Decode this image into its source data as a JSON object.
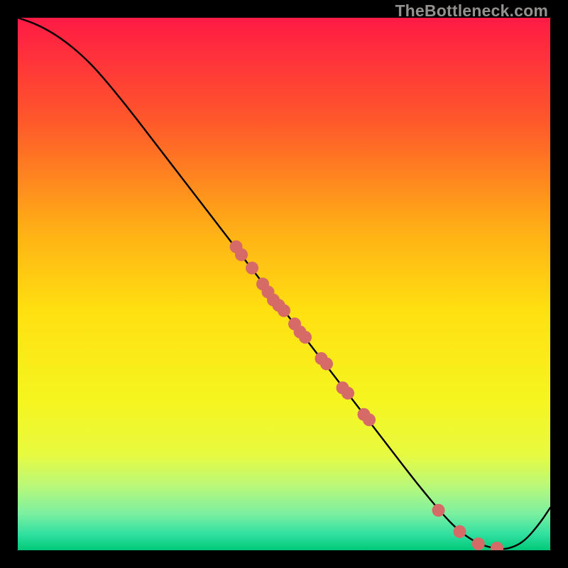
{
  "watermark": "TheBottleneck.com",
  "chart_data": {
    "type": "line",
    "title": "",
    "xlabel": "",
    "ylabel": "",
    "xlim": [
      0,
      100
    ],
    "ylim": [
      0,
      100
    ],
    "grid": false,
    "background_gradient": {
      "stops": [
        {
          "pos": 0.0,
          "color": "#ff1a45"
        },
        {
          "pos": 0.2,
          "color": "#ff5a2a"
        },
        {
          "pos": 0.4,
          "color": "#ffb015"
        },
        {
          "pos": 0.55,
          "color": "#ffe010"
        },
        {
          "pos": 0.72,
          "color": "#f5f520"
        },
        {
          "pos": 0.82,
          "color": "#e8fa40"
        },
        {
          "pos": 0.88,
          "color": "#b8f87a"
        },
        {
          "pos": 0.93,
          "color": "#7ef0a0"
        },
        {
          "pos": 0.97,
          "color": "#30e0a0"
        },
        {
          "pos": 1.0,
          "color": "#00c878"
        }
      ]
    },
    "series": [
      {
        "name": "curve",
        "color": "#000000",
        "x": [
          0,
          3,
          6,
          9,
          12,
          15,
          20,
          25,
          30,
          35,
          40,
          45,
          50,
          55,
          60,
          65,
          70,
          75,
          80,
          83,
          86,
          88,
          90,
          92,
          95,
          98,
          100
        ],
        "y": [
          100,
          99,
          97.5,
          95.5,
          93,
          90,
          84,
          77.5,
          71,
          64.5,
          58,
          51.5,
          45,
          38.5,
          32,
          25.5,
          19,
          12.5,
          6.5,
          3.5,
          1.5,
          0.7,
          0.3,
          0.2,
          1.5,
          5,
          8
        ]
      }
    ],
    "scatter": {
      "name": "markers",
      "color": "#d66a66",
      "radius": 9,
      "points": [
        {
          "x": 41,
          "y": 57
        },
        {
          "x": 42,
          "y": 55.5
        },
        {
          "x": 44,
          "y": 53
        },
        {
          "x": 46,
          "y": 50
        },
        {
          "x": 47,
          "y": 48.5
        },
        {
          "x": 48,
          "y": 47
        },
        {
          "x": 49,
          "y": 46
        },
        {
          "x": 50,
          "y": 45
        },
        {
          "x": 52,
          "y": 42.5
        },
        {
          "x": 53,
          "y": 41
        },
        {
          "x": 54,
          "y": 40
        },
        {
          "x": 57,
          "y": 36
        },
        {
          "x": 58,
          "y": 35
        },
        {
          "x": 61,
          "y": 30.5
        },
        {
          "x": 62,
          "y": 29.5
        },
        {
          "x": 65,
          "y": 25.5
        },
        {
          "x": 66,
          "y": 24.5
        },
        {
          "x": 79,
          "y": 7.5
        },
        {
          "x": 83,
          "y": 3.5
        },
        {
          "x": 86.5,
          "y": 1.2
        },
        {
          "x": 90,
          "y": 0.4
        }
      ]
    }
  }
}
